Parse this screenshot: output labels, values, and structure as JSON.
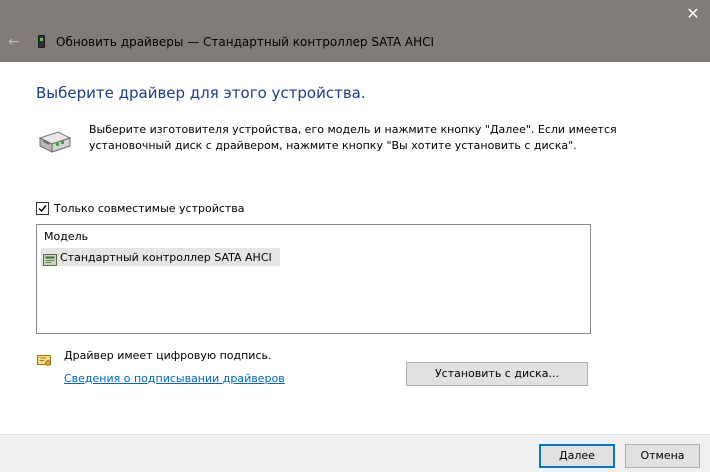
{
  "window": {
    "title": "Обновить драйверы — Стандартный контроллер SATA AHCI",
    "close_glyph": "✕",
    "back_glyph": "←",
    "icons": {
      "close": "close-icon",
      "back": "back-arrow-icon",
      "device": "device-manager-icon"
    }
  },
  "content": {
    "heading": "Выберите драйвер для этого устройства.",
    "description": "Выберите изготовителя устройства, его модель и нажмите кнопку \"Далее\". Если имеется установочный диск с драйвером, нажмите кнопку \"Вы хотите установить с диска\".",
    "hardware_icon": "hardware-device-icon"
  },
  "compat": {
    "label": "Только совместимые устройства",
    "checked": true
  },
  "model_list": {
    "header": "Модель",
    "items": [
      {
        "label": "Стандартный контроллер SATA AHCI",
        "icon": "controller-chip-icon",
        "selected": true
      }
    ]
  },
  "signature": {
    "text": "Драйвер имеет цифровую подпись.",
    "link": "Сведения о подписывании драйверов",
    "icon": "signed-certificate-icon"
  },
  "buttons": {
    "have_disk": "Установить с диска...",
    "next": "Далее",
    "cancel": "Отмена"
  },
  "colors": {
    "titlebar": "#827c79",
    "heading": "#1a3e8f",
    "link": "#0066cc",
    "default_button_border": "#0078d7",
    "footer": "#f0f0f0"
  }
}
